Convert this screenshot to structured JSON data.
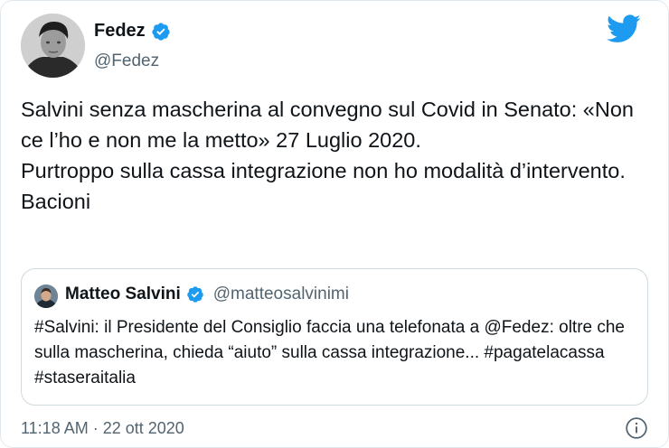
{
  "tweet": {
    "author_name": "Fedez",
    "author_handle": "@Fedez",
    "text": "Salvini senza mascherina al convegno sul Covid in Senato: «Non ce l’ho e non me la metto» 27 Luglio 2020.\nPurtroppo sulla cassa integrazione non ho modalità d’intervento. Bacioni",
    "timestamp": "11:18 AM · 22 ott 2020"
  },
  "quoted_tweet": {
    "author_name": "Matteo Salvini",
    "author_handle": "@matteosalvinimi",
    "text": "#Salvini: il Presidente del Consiglio faccia una telefonata a @Fedez: oltre che sulla mascherina, chieda “aiuto” sulla cassa integrazione... #pagatelacassa #staseraitalia"
  },
  "icons": {
    "verified": "verified-badge-icon",
    "platform": "twitter-bird-icon",
    "info": "info-icon"
  },
  "colors": {
    "brand": "#1d9bf0",
    "text": "#0f1419",
    "secondary": "#536471",
    "border": "#cfd9de"
  }
}
